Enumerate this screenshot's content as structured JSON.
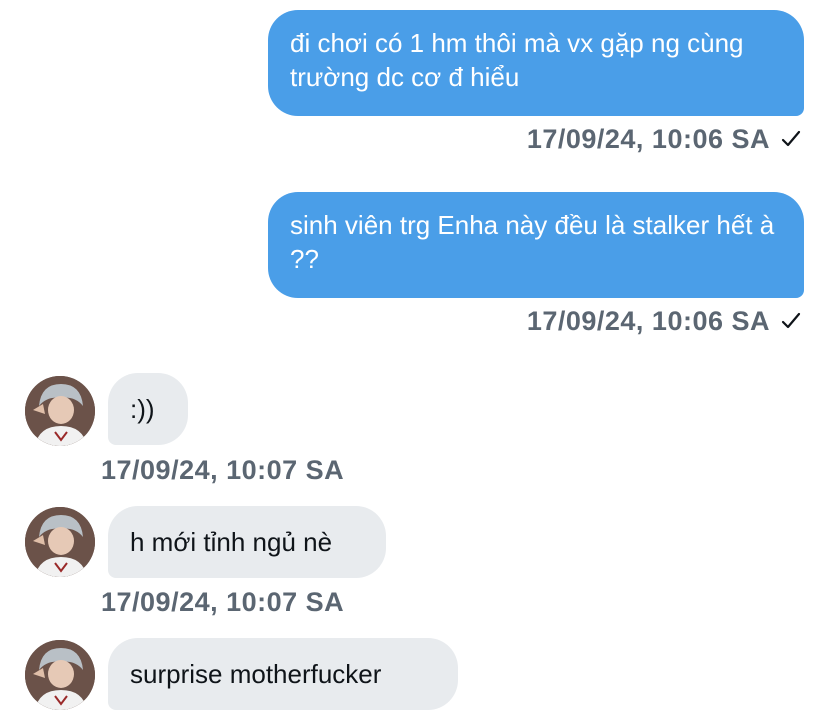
{
  "conversation": {
    "messages": [
      {
        "direction": "sent",
        "text": "đi chơi có 1 hm thôi mà vx gặp ng cùng trường dc cơ đ hiểu",
        "timestamp": "17/09/24, 10:06 SA",
        "status": "sent-check"
      },
      {
        "direction": "sent",
        "text": "sinh viên trg Enha này đều là stalker hết à ??",
        "timestamp": "17/09/24, 10:06 SA",
        "status": "sent-check"
      },
      {
        "direction": "received",
        "text": ":))",
        "timestamp": "17/09/24, 10:07 SA"
      },
      {
        "direction": "received",
        "text": "h mới tỉnh ngủ nè",
        "timestamp": "17/09/24, 10:07 SA"
      },
      {
        "direction": "received",
        "text": "surprise motherfucker",
        "timestamp": ""
      }
    ]
  },
  "colors": {
    "sent_bubble": "#4a9ee8",
    "received_bubble": "#e8ebee",
    "timestamp_text": "#5b6672"
  },
  "icons": {
    "status": "check-icon",
    "avatar": "user-avatar"
  }
}
